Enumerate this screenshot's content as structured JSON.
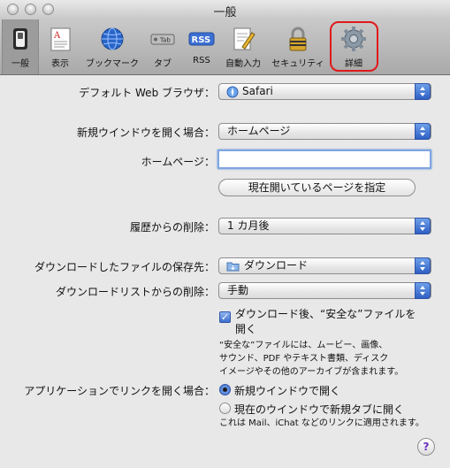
{
  "window": {
    "title": "一般"
  },
  "toolbar": {
    "items": [
      {
        "label": "一般",
        "icon": "general-switch-icon",
        "selected": true
      },
      {
        "label": "表示",
        "icon": "appearance-icon"
      },
      {
        "label": "ブックマーク",
        "icon": "globe-icon"
      },
      {
        "label": "タブ",
        "icon": "tab-icon",
        "icon_text": "Tab"
      },
      {
        "label": "RSS",
        "icon": "rss-icon",
        "icon_text": "RSS"
      },
      {
        "label": "自動入力",
        "icon": "autofill-icon"
      },
      {
        "label": "セキュリティ",
        "icon": "lock-icon"
      },
      {
        "label": "詳細",
        "icon": "gear-icon",
        "highlighted": true
      }
    ]
  },
  "settings": {
    "default_browser": {
      "label": "デフォルト Web ブラウザ：",
      "value": "Safari"
    },
    "new_window": {
      "label": "新規ウインドウを開く場合：",
      "value": "ホームページ"
    },
    "homepage": {
      "label": "ホームページ：",
      "value": "",
      "button": "現在開いているページを指定"
    },
    "history": {
      "label": "履歴からの削除：",
      "value": "1 カ月後"
    },
    "download_location": {
      "label": "ダウンロードしたファイルの保存先：",
      "value": "ダウンロード"
    },
    "download_list": {
      "label": "ダウンロードリストからの削除：",
      "value": "手動"
    },
    "open_safe": {
      "label_line1": "ダウンロード後、“安全な”ファイルを",
      "label_line2": "開く",
      "checked": true,
      "note_line1": "“安全な”ファイルには、ムービー、画像、",
      "note_line2": "サウンド、PDF やテキスト書類、ディスク",
      "note_line3": "イメージやその他のアーカイブが含まれます。"
    },
    "app_links": {
      "label": "アプリケーションでリンクを開く場合：",
      "option1": "新規ウインドウで開く",
      "option2": "現在のウインドウで新規タブに開く",
      "selected": "新規ウインドウで開く",
      "note": "これは Mail、iChat などのリンクに適用されます。"
    }
  },
  "help": {
    "label": "?"
  },
  "colors": {
    "accent": "#3d6fcd",
    "highlight": "#e0191a"
  }
}
